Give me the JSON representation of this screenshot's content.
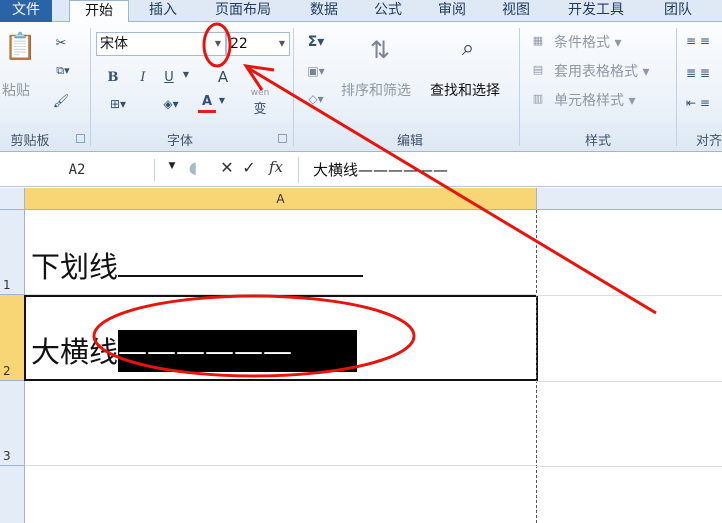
{
  "tabs": [
    {
      "label": "文件"
    },
    {
      "label": "开始"
    },
    {
      "label": "插入"
    },
    {
      "label": "页面布局"
    },
    {
      "label": "数据"
    },
    {
      "label": "公式"
    },
    {
      "label": "审阅"
    },
    {
      "label": "视图"
    },
    {
      "label": "开发工具"
    },
    {
      "label": "团队"
    }
  ],
  "ribbon": {
    "clipboard": {
      "paste_label": "粘贴",
      "group_label": "剪贴板"
    },
    "font": {
      "font_name": "宋体",
      "font_size": "22",
      "bold": "B",
      "italic": "I",
      "underline": "U",
      "grow": "A",
      "color_a": "A",
      "wen": "wén",
      "wen_char": "变",
      "group_label": "字体"
    },
    "editing": {
      "sort_label": "排序和筛选",
      "find_label": "查找和选择",
      "group_label": "编辑"
    },
    "styles": {
      "cond_format": "条件格式",
      "table_format": "套用表格格式",
      "cell_style": "单元格样式",
      "group_label": "样式"
    },
    "align": {
      "group_label": "对齐"
    }
  },
  "formula_bar": {
    "name_box": "A2",
    "value": "大横线——————"
  },
  "sheet": {
    "column_header": "A",
    "rows": [
      {
        "num": "1",
        "text": "下划线"
      },
      {
        "num": "2",
        "text": "大横线",
        "fill_text": "——————"
      },
      {
        "num": "3",
        "text": ""
      }
    ]
  },
  "colors": {
    "annotation": "#e8140c",
    "selected_header": "#f8d675",
    "file_tab": "#2a64a8"
  }
}
